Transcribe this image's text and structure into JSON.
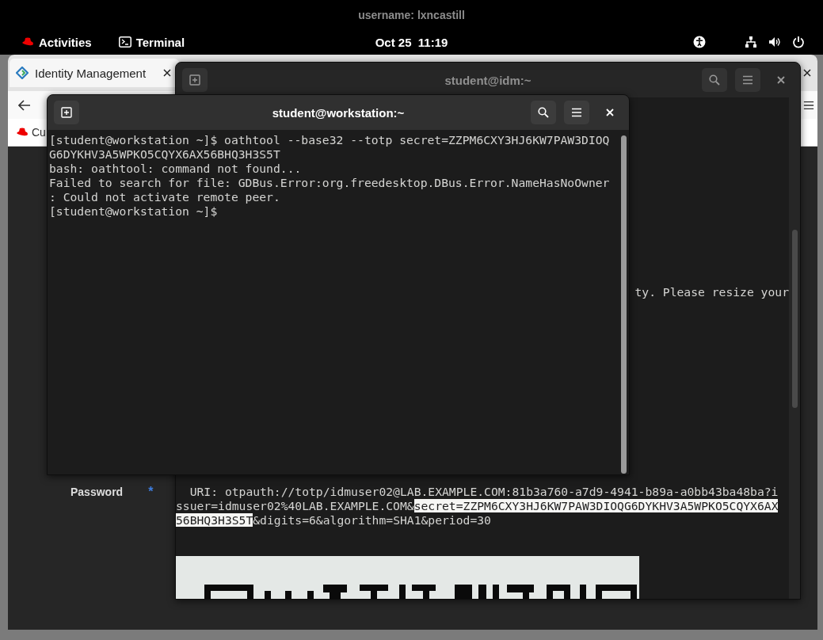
{
  "recording_banner": {
    "text": "username: lxncastill"
  },
  "top_bar": {
    "activities": "Activities",
    "app": "Terminal",
    "clock": "Oct 25  11:19"
  },
  "browser": {
    "tabs": [
      {
        "label": "Identity Management",
        "selected": true
      }
    ],
    "bookmark": "Cu",
    "form_label": "Password",
    "required_mark": "*"
  },
  "terminals": [
    {
      "title": "student@idm:~",
      "focused": false,
      "lines": [
        {
          "kind": "tail",
          "segments": [
            {
              "text": "ty. Please resize your",
              "selected": false
            }
          ]
        },
        {
          "kind": "lower",
          "segments": [
            {
              "text": "  URI: otpauth://totp/idmuser02@LAB.EXAMPLE.COM:81b3a760-a7d9-4941-b89a-a0bb43ba48ba?i",
              "selected": false
            }
          ]
        },
        {
          "kind": "text",
          "segments": [
            {
              "text": "ssuer=idmuser02%40LAB.EXAMPLE.COM&",
              "selected": false
            },
            {
              "text": "secret=ZZPM6CXY3HJ6KW7PAW3DIOQG6DYKHV3A5WPKO5CQYX6AX",
              "selected": true
            }
          ]
        },
        {
          "kind": "text",
          "segments": [
            {
              "text": "56BHQ3H3S5T",
              "selected": true
            },
            {
              "text": "&digits=6&algorithm=SHA1&period=30",
              "selected": false
            }
          ]
        }
      ],
      "qr_code": true
    },
    {
      "title": "student@workstation:~",
      "focused": true,
      "lines": [
        {
          "kind": "text",
          "segments": [
            {
              "text": "[student@workstation ~]$ oathtool --base32 --totp secret=ZZPM6CXY3HJ6KW7PAW3DIOQ",
              "selected": false
            }
          ]
        },
        {
          "kind": "text",
          "segments": [
            {
              "text": "G6DYKHV3A5WPKO5CQYX6AX56BHQ3H3S5T",
              "selected": false
            }
          ]
        },
        {
          "kind": "text",
          "segments": [
            {
              "text": "bash: oathtool: command not found...",
              "selected": false
            }
          ]
        },
        {
          "kind": "text",
          "segments": [
            {
              "text": "Failed to search for file: GDBus.Error:org.freedesktop.DBus.Error.NameHasNoOwner",
              "selected": false
            }
          ]
        },
        {
          "kind": "text",
          "segments": [
            {
              "text": ": Could not activate remote peer.",
              "selected": false
            }
          ]
        },
        {
          "kind": "text",
          "segments": [
            {
              "text": "[student@workstation ~]$ ",
              "selected": false
            }
          ]
        }
      ]
    }
  ]
}
